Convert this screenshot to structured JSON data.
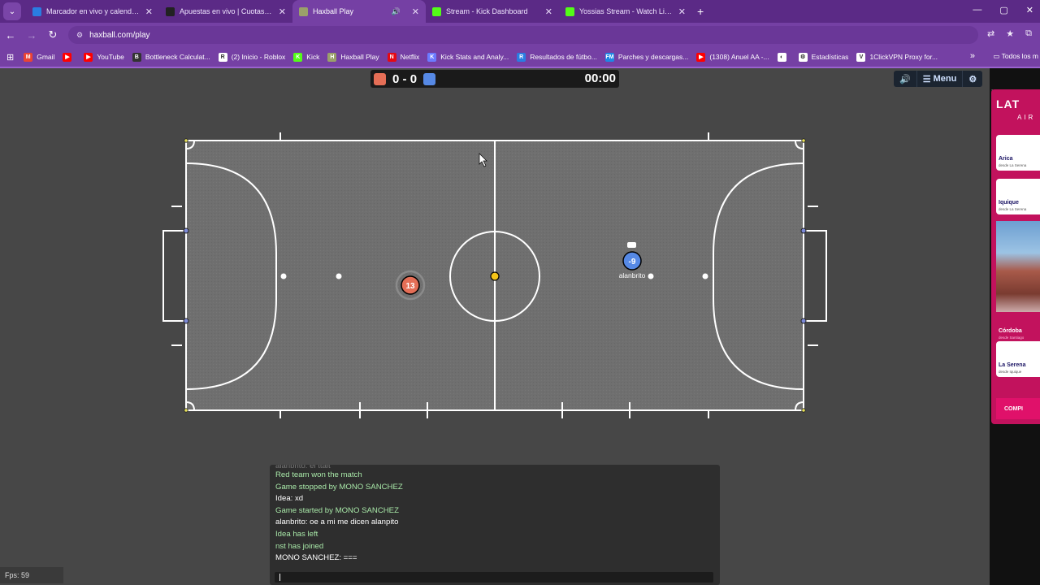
{
  "tabs": [
    {
      "title": "Marcador en vivo y calendario",
      "favicon": "dazn-favicon",
      "color": "#2a7de1",
      "active": false
    },
    {
      "title": "Apuestas en vivo | Cuotas en vi",
      "favicon": "betting-favicon",
      "color": "#222222",
      "active": false
    },
    {
      "title": "Haxball Play",
      "favicon": "haxball-favicon",
      "color": "#9aa06a",
      "active": true
    },
    {
      "title": "Stream - Kick Dashboard",
      "favicon": "kick-favicon",
      "color": "#53fc18",
      "active": false
    },
    {
      "title": "Yossias Stream - Watch Live on",
      "favicon": "kick-favicon",
      "color": "#53fc18",
      "active": false
    }
  ],
  "address": {
    "url": "haxball.com/play"
  },
  "bookmarks": [
    {
      "label": "Gmail",
      "color": "#ea4335",
      "glyph": "M"
    },
    {
      "label": "",
      "color": "#ff0000",
      "glyph": "▶"
    },
    {
      "label": "YouTube",
      "color": "#ff0000",
      "glyph": "▶"
    },
    {
      "label": "Bottleneck Calculat...",
      "color": "#333333",
      "glyph": "B"
    },
    {
      "label": "(2) Inicio - Roblox",
      "color": "#ffffff",
      "glyph": "R"
    },
    {
      "label": "Kick",
      "color": "#53fc18",
      "glyph": "K"
    },
    {
      "label": "Haxball Play",
      "color": "#9aa06a",
      "glyph": "H"
    },
    {
      "label": "Netflix",
      "color": "#e50914",
      "glyph": "N"
    },
    {
      "label": "Kick Stats and Analy...",
      "color": "#6b7bff",
      "glyph": "K"
    },
    {
      "label": "Resultados de fútbo...",
      "color": "#2a7de1",
      "glyph": "R"
    },
    {
      "label": "Parches y descargas...",
      "color": "#1e88e5",
      "glyph": "FM"
    },
    {
      "label": "(1308) Anuel AA -...",
      "color": "#ff0000",
      "glyph": "▶"
    },
    {
      "label": "",
      "color": "#ffffff",
      "glyph": "◐"
    },
    {
      "label": "Estadísticas",
      "color": "#ffffff",
      "glyph": "⚙"
    },
    {
      "label": "1ClickVPN Proxy for...",
      "color": "#ffffff",
      "glyph": "V"
    }
  ],
  "bookmarks_folder": "Todos los m",
  "game": {
    "score_red": "0",
    "score_sep": "-",
    "score_blue": "0",
    "timer": "00:00",
    "red_color": "#e56e56",
    "blue_color": "#5689e5",
    "menu_label": "Menu",
    "red_player_number": "13",
    "blue_player_number": "-9",
    "blue_player_name": "alanbrito"
  },
  "chat": {
    "messages": [
      {
        "text": "alanbrito: el ttalt",
        "kind": "cut"
      },
      {
        "text": "Red team won the match",
        "kind": "sys"
      },
      {
        "text": "Game stopped by MONO SANCHEZ",
        "kind": "sys"
      },
      {
        "text": "Idea: xd",
        "kind": "usr"
      },
      {
        "text": "Game started by MONO SANCHEZ",
        "kind": "sys"
      },
      {
        "text": "alanbrito: oe a mi me dicen alanpito",
        "kind": "usr"
      },
      {
        "text": "Idea has left",
        "kind": "sys"
      },
      {
        "text": "nst has joined",
        "kind": "sys"
      },
      {
        "text": "MONO SANCHEZ: ===",
        "kind": "usr"
      }
    ]
  },
  "fps": "Fps: 59",
  "ad": {
    "logo": "LAT",
    "logo_sub": "AIR",
    "cards": [
      {
        "city": "Arica",
        "from": "desde La Serena"
      },
      {
        "city": "Iquique",
        "from": "desde La Serena"
      },
      {
        "city": "Córdoba",
        "from": "desde Santiago"
      },
      {
        "city": "La Serena",
        "from": "desde Iquique"
      }
    ],
    "cta": "COMPI"
  }
}
